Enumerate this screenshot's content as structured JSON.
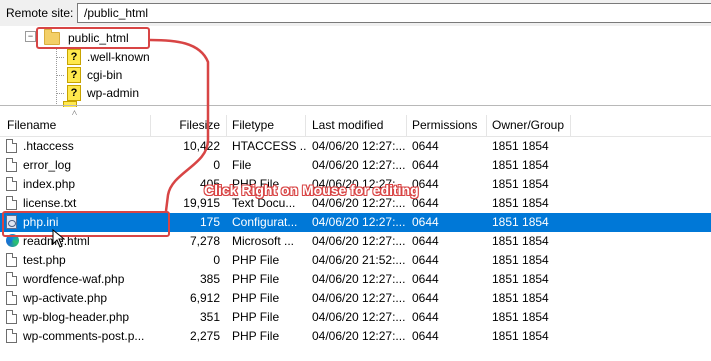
{
  "remote_site": {
    "label": "Remote site:",
    "path": "/public_html"
  },
  "tree": {
    "expander": "−",
    "root": "public_html",
    "children": [
      ".well-known",
      "cgi-bin",
      "wp-admin"
    ]
  },
  "columns": {
    "filename": "Filename",
    "filesize": "Filesize",
    "filetype": "Filetype",
    "last_modified": "Last modified",
    "permissions": "Permissions",
    "owner_group": "Owner/Group"
  },
  "files": [
    {
      "name": ".htaccess",
      "size": "10,422",
      "type": "HTACCESS ...",
      "modified": "04/06/20 12:27:...",
      "perm": "0644",
      "owner": "1851 1854",
      "icon": "document-icon"
    },
    {
      "name": "error_log",
      "size": "0",
      "type": "File",
      "modified": "04/06/20 12:27:...",
      "perm": "0644",
      "owner": "1851 1854",
      "icon": "document-icon"
    },
    {
      "name": "index.php",
      "size": "405",
      "type": "PHP File",
      "modified": "04/06/20 12:27:...",
      "perm": "0644",
      "owner": "1851 1854",
      "icon": "document-icon"
    },
    {
      "name": "license.txt",
      "size": "19,915",
      "type": "Text Docu...",
      "modified": "04/06/20 12:27:...",
      "perm": "0644",
      "owner": "1851 1854",
      "icon": "document-icon"
    },
    {
      "name": "php.ini",
      "size": "175",
      "type": "Configurat...",
      "modified": "04/06/20 12:27:...",
      "perm": "0644",
      "owner": "1851 1854",
      "icon": "config-file-icon"
    },
    {
      "name": "readme.html",
      "size": "7,278",
      "type": "Microsoft ...",
      "modified": "04/06/20 12:27:...",
      "perm": "0644",
      "owner": "1851 1854",
      "icon": "edge-icon"
    },
    {
      "name": "test.php",
      "size": "0",
      "type": "PHP File",
      "modified": "04/06/20 21:52:...",
      "perm": "0644",
      "owner": "1851 1854",
      "icon": "document-icon"
    },
    {
      "name": "wordfence-waf.php",
      "size": "385",
      "type": "PHP File",
      "modified": "04/06/20 12:27:...",
      "perm": "0644",
      "owner": "1851 1854",
      "icon": "document-icon"
    },
    {
      "name": "wp-activate.php",
      "size": "6,912",
      "type": "PHP File",
      "modified": "04/06/20 12:27:...",
      "perm": "0644",
      "owner": "1851 1854",
      "icon": "document-icon"
    },
    {
      "name": "wp-blog-header.php",
      "size": "351",
      "type": "PHP File",
      "modified": "04/06/20 12:27:...",
      "perm": "0644",
      "owner": "1851 1854",
      "icon": "document-icon"
    },
    {
      "name": "wp-comments-post.p...",
      "size": "2,275",
      "type": "PHP File",
      "modified": "04/06/20 12:27:...",
      "perm": "0644",
      "owner": "1851 1854",
      "icon": "document-icon"
    }
  ],
  "selected_file": "php.ini",
  "annotation": {
    "text": "Click Right on Mouse for editing",
    "color": "#d84545"
  },
  "colors": {
    "selection": "#0078d7",
    "annotation": "#d84545"
  }
}
